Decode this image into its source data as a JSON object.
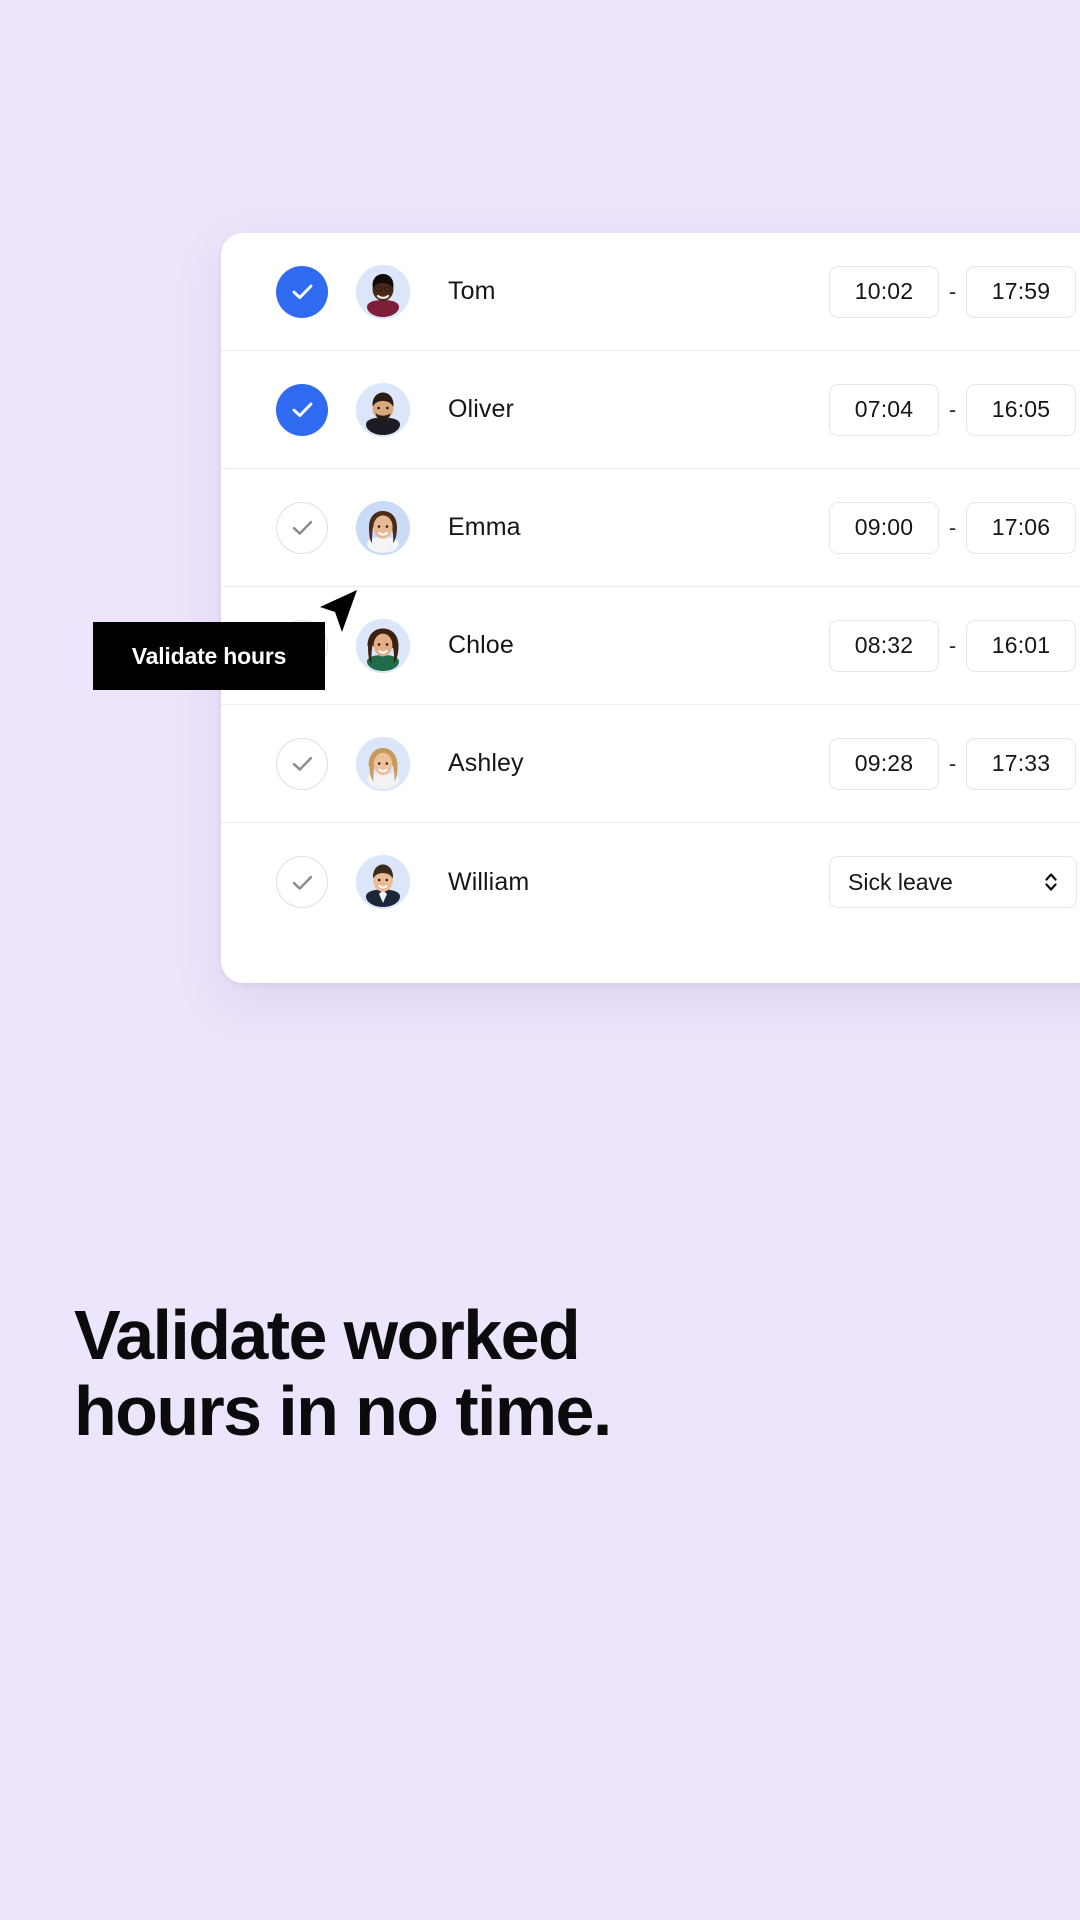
{
  "theme": {
    "background": "#EDE5FB",
    "card_background": "#FFFFFF",
    "accent_blue": "#2F6BF0",
    "avatar_background": "#DCE6FB",
    "border": "#E6E5EA",
    "row_divider": "#EEEDF2",
    "tooltip_background": "#000000",
    "tooltip_text": "#FFFFFF",
    "text_primary": "#15161A",
    "headline_color": "#0B0B0D"
  },
  "card": {
    "separator": "-",
    "rows": [
      {
        "name": "Tom",
        "checked": true,
        "check_icon": "check-icon",
        "avatar": "avatar-tom",
        "start": "10:02",
        "end": "17:59",
        "type": "time"
      },
      {
        "name": "Oliver",
        "checked": true,
        "check_icon": "check-icon",
        "avatar": "avatar-oliver",
        "start": "07:04",
        "end": "16:05",
        "type": "time"
      },
      {
        "name": "Emma",
        "checked": false,
        "check_icon": "check-icon",
        "avatar": "avatar-emma",
        "start": "09:00",
        "end": "17:06",
        "type": "time"
      },
      {
        "name": "Chloe",
        "checked": false,
        "check_icon": "check-icon",
        "avatar": "avatar-chloe",
        "start": "08:32",
        "end": "16:01",
        "type": "time"
      },
      {
        "name": "Ashley",
        "checked": false,
        "check_icon": "check-icon",
        "avatar": "avatar-ashley",
        "start": "09:28",
        "end": "17:33",
        "type": "time"
      },
      {
        "name": "William",
        "checked": false,
        "check_icon": "check-icon",
        "avatar": "avatar-william",
        "status": "Sick leave",
        "type": "select"
      }
    ]
  },
  "tooltip": {
    "label": "Validate hours",
    "cursor_icon": "cursor-arrow-icon"
  },
  "headline": {
    "line1": "Validate worked",
    "line2": "hours in no time."
  }
}
